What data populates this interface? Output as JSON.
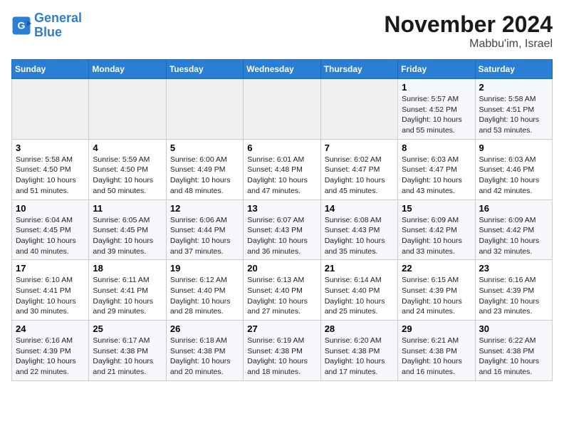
{
  "logo": {
    "name1": "General",
    "name2": "Blue"
  },
  "title": "November 2024",
  "location": "Mabbu'im, Israel",
  "weekdays": [
    "Sunday",
    "Monday",
    "Tuesday",
    "Wednesday",
    "Thursday",
    "Friday",
    "Saturday"
  ],
  "weeks": [
    [
      {
        "day": "",
        "info": ""
      },
      {
        "day": "",
        "info": ""
      },
      {
        "day": "",
        "info": ""
      },
      {
        "day": "",
        "info": ""
      },
      {
        "day": "",
        "info": ""
      },
      {
        "day": "1",
        "info": "Sunrise: 5:57 AM\nSunset: 4:52 PM\nDaylight: 10 hours and 55 minutes."
      },
      {
        "day": "2",
        "info": "Sunrise: 5:58 AM\nSunset: 4:51 PM\nDaylight: 10 hours and 53 minutes."
      }
    ],
    [
      {
        "day": "3",
        "info": "Sunrise: 5:58 AM\nSunset: 4:50 PM\nDaylight: 10 hours and 51 minutes."
      },
      {
        "day": "4",
        "info": "Sunrise: 5:59 AM\nSunset: 4:50 PM\nDaylight: 10 hours and 50 minutes."
      },
      {
        "day": "5",
        "info": "Sunrise: 6:00 AM\nSunset: 4:49 PM\nDaylight: 10 hours and 48 minutes."
      },
      {
        "day": "6",
        "info": "Sunrise: 6:01 AM\nSunset: 4:48 PM\nDaylight: 10 hours and 47 minutes."
      },
      {
        "day": "7",
        "info": "Sunrise: 6:02 AM\nSunset: 4:47 PM\nDaylight: 10 hours and 45 minutes."
      },
      {
        "day": "8",
        "info": "Sunrise: 6:03 AM\nSunset: 4:47 PM\nDaylight: 10 hours and 43 minutes."
      },
      {
        "day": "9",
        "info": "Sunrise: 6:03 AM\nSunset: 4:46 PM\nDaylight: 10 hours and 42 minutes."
      }
    ],
    [
      {
        "day": "10",
        "info": "Sunrise: 6:04 AM\nSunset: 4:45 PM\nDaylight: 10 hours and 40 minutes."
      },
      {
        "day": "11",
        "info": "Sunrise: 6:05 AM\nSunset: 4:45 PM\nDaylight: 10 hours and 39 minutes."
      },
      {
        "day": "12",
        "info": "Sunrise: 6:06 AM\nSunset: 4:44 PM\nDaylight: 10 hours and 37 minutes."
      },
      {
        "day": "13",
        "info": "Sunrise: 6:07 AM\nSunset: 4:43 PM\nDaylight: 10 hours and 36 minutes."
      },
      {
        "day": "14",
        "info": "Sunrise: 6:08 AM\nSunset: 4:43 PM\nDaylight: 10 hours and 35 minutes."
      },
      {
        "day": "15",
        "info": "Sunrise: 6:09 AM\nSunset: 4:42 PM\nDaylight: 10 hours and 33 minutes."
      },
      {
        "day": "16",
        "info": "Sunrise: 6:09 AM\nSunset: 4:42 PM\nDaylight: 10 hours and 32 minutes."
      }
    ],
    [
      {
        "day": "17",
        "info": "Sunrise: 6:10 AM\nSunset: 4:41 PM\nDaylight: 10 hours and 30 minutes."
      },
      {
        "day": "18",
        "info": "Sunrise: 6:11 AM\nSunset: 4:41 PM\nDaylight: 10 hours and 29 minutes."
      },
      {
        "day": "19",
        "info": "Sunrise: 6:12 AM\nSunset: 4:40 PM\nDaylight: 10 hours and 28 minutes."
      },
      {
        "day": "20",
        "info": "Sunrise: 6:13 AM\nSunset: 4:40 PM\nDaylight: 10 hours and 27 minutes."
      },
      {
        "day": "21",
        "info": "Sunrise: 6:14 AM\nSunset: 4:40 PM\nDaylight: 10 hours and 25 minutes."
      },
      {
        "day": "22",
        "info": "Sunrise: 6:15 AM\nSunset: 4:39 PM\nDaylight: 10 hours and 24 minutes."
      },
      {
        "day": "23",
        "info": "Sunrise: 6:16 AM\nSunset: 4:39 PM\nDaylight: 10 hours and 23 minutes."
      }
    ],
    [
      {
        "day": "24",
        "info": "Sunrise: 6:16 AM\nSunset: 4:39 PM\nDaylight: 10 hours and 22 minutes."
      },
      {
        "day": "25",
        "info": "Sunrise: 6:17 AM\nSunset: 4:38 PM\nDaylight: 10 hours and 21 minutes."
      },
      {
        "day": "26",
        "info": "Sunrise: 6:18 AM\nSunset: 4:38 PM\nDaylight: 10 hours and 20 minutes."
      },
      {
        "day": "27",
        "info": "Sunrise: 6:19 AM\nSunset: 4:38 PM\nDaylight: 10 hours and 18 minutes."
      },
      {
        "day": "28",
        "info": "Sunrise: 6:20 AM\nSunset: 4:38 PM\nDaylight: 10 hours and 17 minutes."
      },
      {
        "day": "29",
        "info": "Sunrise: 6:21 AM\nSunset: 4:38 PM\nDaylight: 10 hours and 16 minutes."
      },
      {
        "day": "30",
        "info": "Sunrise: 6:22 AM\nSunset: 4:38 PM\nDaylight: 10 hours and 16 minutes."
      }
    ]
  ]
}
